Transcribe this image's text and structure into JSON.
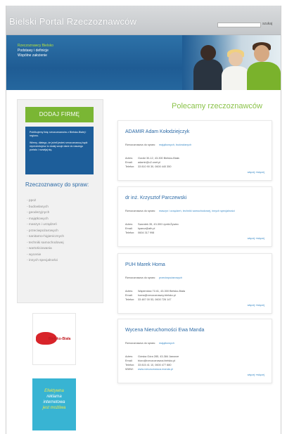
{
  "header": {
    "site_title": "Bielski Portal Rzeczoznawców",
    "search_button": "szukaj"
  },
  "banner": {
    "menu": [
      "Rzeczoznawcy Bielsko",
      "Podstawy i definicje",
      "Wspólne założenie"
    ]
  },
  "sidebar": {
    "add_firm": "DODAJ FIRMĘ",
    "info": [
      "Publikujemy listę rzeczoznawców z Bielska-Białej i regionu.",
      "Wiemy, dlatego, że jeżeli jesteś rzeczoznawcą bądź reprezentujesz to dodaj swoje dane do naszego portalu i rozwijaj się."
    ],
    "categories_heading": "Rzeczoznawcy do spraw:",
    "categories": [
      "- ppoż",
      "- budowlanych",
      "- geodezyjnych",
      "- majątkowych",
      "- maszyn i urządzeń",
      "- przeciwpożarowych",
      "- sanitarno-higienicznych",
      "- techniki samochodowej",
      "- wartościowania",
      "- wycenie",
      "- innych specjalności"
    ]
  },
  "ads": {
    "bielsko_text": "Bielsko-Biała",
    "promo_lines": [
      "Efektywna",
      "reklama",
      "internetowa",
      "jest możliwa"
    ]
  },
  "main": {
    "section_title": "Polecamy rzeczoznawców",
    "spec_label": "Rzeczoznawca do spraw:",
    "address_label": "Adres:",
    "email_label": "Email:",
    "phone_label": "Telefon:",
    "www_label": "WWW:",
    "more_label": "więcej »więcej",
    "listings": [
      {
        "name": "ADAMIR Adam Kołodziejczyk",
        "spec": "majątkowych, budowlanych",
        "address": "Gorzki 30-12, 43-300 Bielsko-Biała",
        "email": "adamir@o2.onet.pl",
        "phone": "33 810 90 30, 0600 440 350"
      },
      {
        "name": "dr inż. Krzysztof Parczewski",
        "spec": "maszyn i urządzeń, techniki samochodowej, innych specjalności",
        "address": "Szarotek 35, 43-300 Lipnik/Żywiec",
        "email": "kparcz@ath.pl",
        "phone": "0604 317 998"
      },
      {
        "name": "PUH Marek Homa",
        "spec": "przeciwpożarowych",
        "address": "Wapienicka 71/41, 43-300 Bielsko-Biała",
        "email": "homa@rzeczoznawcy.bielsko.pl",
        "phone": "33 487 00 53, 0600 726 147"
      },
      {
        "name": "Wycena Nieruchomości Ewa Manda",
        "spec": "majątkowych",
        "address": "Górska Góra 285, 43-384 Jaworze",
        "email": "biuro@rzeczoznawca.bielsko.pl",
        "phone": "33 815 41 10, 0600 477 880",
        "www": "www.rzeczoznawca.manda.pl"
      }
    ]
  }
}
